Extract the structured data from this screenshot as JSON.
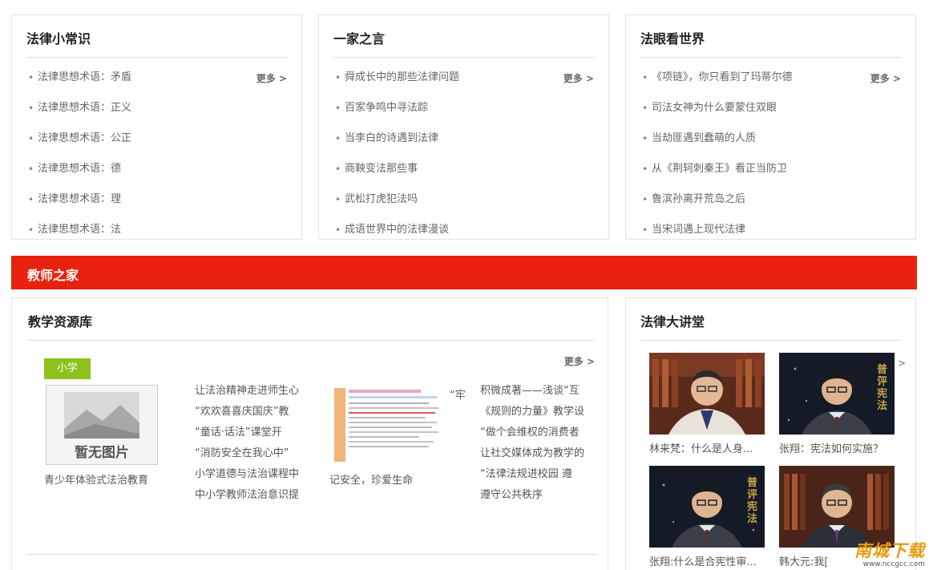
{
  "panels": [
    {
      "title": "法律小常识",
      "more": "更多 >",
      "items": [
        "法律思想术语：矛盾",
        "法律思想术语：正义",
        "法律思想术语：公正",
        "法律思想术语：德",
        "法律思想术语：理",
        "法律思想术语：法"
      ]
    },
    {
      "title": "一家之言",
      "more": "更多 >",
      "items": [
        "舜成长中的那些法律问题",
        "百家争鸣中寻法踪",
        "当李白的诗遇到法律",
        "商鞅变法那些事",
        "武松打虎犯法吗",
        "成语世界中的法律漫谈"
      ]
    },
    {
      "title": "法眼看世界",
      "more": "更多 >",
      "items": [
        "《项链》，你只看到了玛蒂尔德",
        "司法女神为什么要蒙住双眼",
        "当劫匪遇到蠢萌的人质",
        "从《荆轲刺秦王》看正当防卫",
        "鲁滨孙离开荒岛之后",
        "当宋词遇上现代法律"
      ]
    }
  ],
  "teacher_bar": {
    "title": "教师之家"
  },
  "resources": {
    "title": "教学资源库",
    "tag": "小学",
    "more": "更多 >",
    "no_image_text": "暂无图片",
    "caption_left": "青少年体验式法治教育",
    "caption_mid": "记安全，珍爱生命",
    "orphan_text": "“牢",
    "list_a": [
      "让法治精神走进师生心",
      "“欢欢喜喜庆国庆”教",
      "“童话·话法”课堂开",
      "“消防安全在我心中”",
      "小学道德与法治课程中",
      "中小学教师法治意识提"
    ],
    "list_b": [
      "积微成著——浅谈“互",
      "《规则的力量》教学设",
      "“做个会维权的消费者",
      "让社交媒体成为教学的",
      "“法律法规进校园 遵",
      "遵守公共秩序"
    ]
  },
  "lectures": {
    "title": "法律大讲堂",
    "arrow": ">",
    "videos": [
      {
        "caption": "林来梵：什么是人身...",
        "thumb_text": ""
      },
      {
        "caption": "张翔：宪法如何实施？",
        "thumb_text": "普评宪法"
      },
      {
        "caption": "张翔:什么是合宪性审...",
        "thumb_text": "普评宪法"
      },
      {
        "caption": "韩大元:我[",
        "thumb_text": ""
      }
    ]
  },
  "watermark": {
    "main": "南城下载",
    "sub": "www.nccgcc.com"
  },
  "colors": {
    "accent": "#e8220e",
    "tag_green": "#8cc21b",
    "watermark": "#e89a0c"
  }
}
